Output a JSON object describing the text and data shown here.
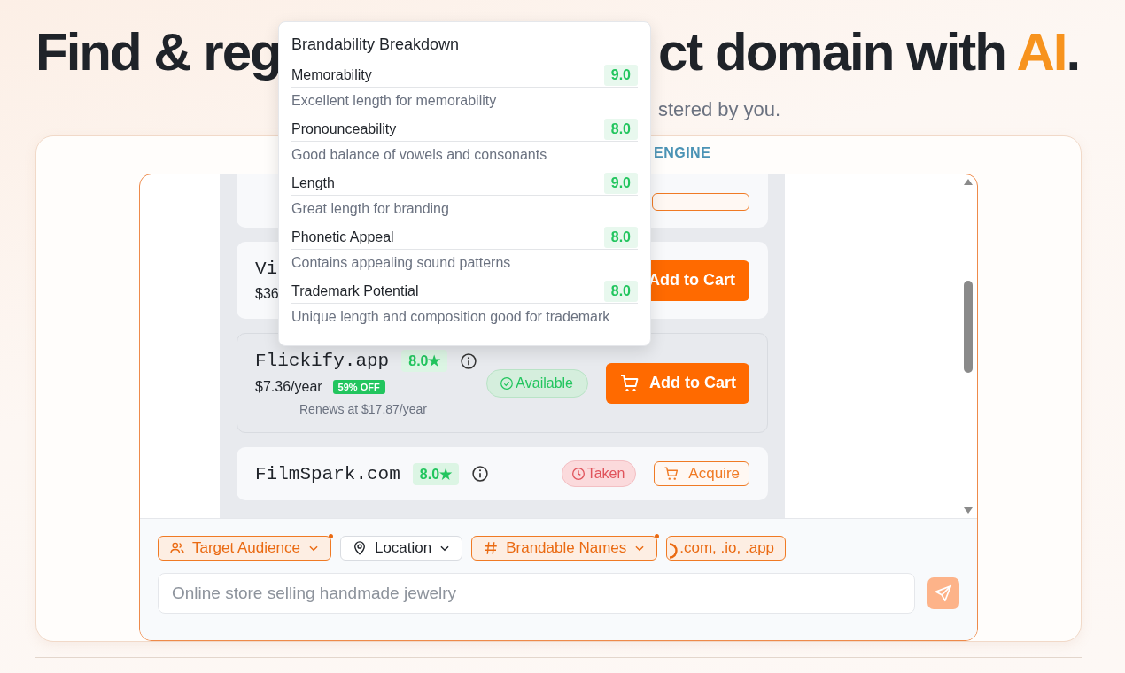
{
  "heading": {
    "left": "Find & reg",
    "right": "ct domain with",
    "accent": "AI",
    "end": "."
  },
  "subtitle": "stered by you.",
  "engine_label": "ENGINE",
  "cards": [
    {
      "kind": "clipped",
      "action": {
        "kind": "acquire_clipped"
      }
    },
    {
      "kind": "covered",
      "name": "Vi",
      "price": "$36",
      "action": {
        "kind": "buy_covered",
        "label": "Add to Cart"
      }
    },
    {
      "kind": "full",
      "active": true,
      "name": "Flickify.app",
      "rating": "8.0★",
      "price": "$7.36/year",
      "discount": "59% OFF",
      "renewal": "Renews at $17.87/year",
      "status": {
        "kind": "available",
        "label": "Available"
      },
      "action": {
        "kind": "buy",
        "label": "Add to Cart"
      }
    },
    {
      "kind": "full",
      "active": false,
      "name": "FilmSpark.com",
      "rating": "8.0★",
      "status": {
        "kind": "taken",
        "label": "Taken"
      },
      "action": {
        "kind": "acquire",
        "label": "Acquire"
      }
    }
  ],
  "filters": [
    {
      "kind": "audience",
      "label": "Target Audience",
      "active": true,
      "modified": true
    },
    {
      "kind": "location",
      "label": "Location",
      "active": false,
      "modified": false
    },
    {
      "kind": "style",
      "label": "Brandable Names",
      "active": true,
      "modified": true
    },
    {
      "kind": "extensions",
      "label": ".com, .io, .app",
      "active": true,
      "modified": false
    }
  ],
  "prompt": {
    "placeholder": "Online store selling handmade jewelry"
  },
  "popup": {
    "title": "Brandability Breakdown",
    "metrics": [
      {
        "label": "Memorability",
        "score": "9.0",
        "note": "Excellent length for memorability"
      },
      {
        "label": "Pronounceability",
        "score": "8.0",
        "note": "Good balance of vowels and consonants"
      },
      {
        "label": "Length",
        "score": "9.0",
        "note": "Great length for branding"
      },
      {
        "label": "Phonetic Appeal",
        "score": "8.0",
        "note": "Contains appealing sound patterns"
      },
      {
        "label": "Trademark Potential",
        "score": "8.0",
        "note": "Unique length and composition good for trademark"
      }
    ]
  }
}
